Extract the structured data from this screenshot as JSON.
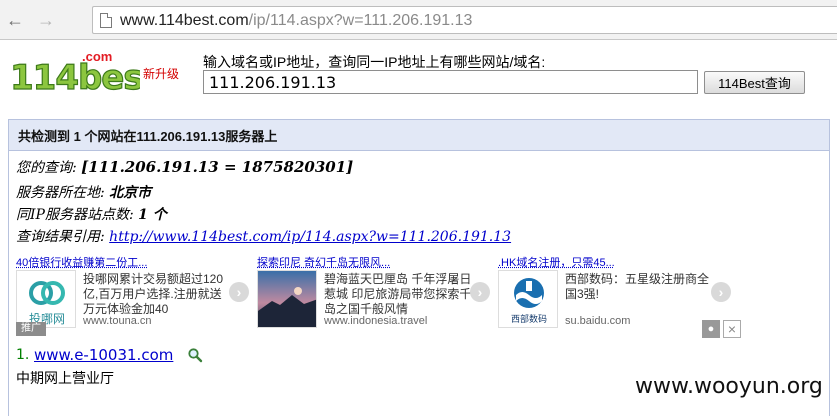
{
  "browser": {
    "url_host": "www.114best.com",
    "url_path": "/ip/114.aspx?w=111.206.191.13",
    "back_icon": "arrow-left-icon",
    "forward_icon": "arrow-right-icon"
  },
  "header": {
    "logo_text": "114best",
    "logo_suffix": ".com",
    "new_tag": "新升级",
    "search_hint": "输入域名或IP地址，查询同一IP地址上有哪些网站/域名:",
    "search_value": "111.206.191.13",
    "search_button": "114Best查询"
  },
  "result": {
    "summary": "共检测到 1 个网站在111.206.191.13服务器上",
    "query_label": "您的查询: ",
    "query_value": "[111.206.191.13 = 1875820301]",
    "location_label": "服务器所在地: ",
    "location_value": "北京市",
    "count_label": "同IP服务器站点数: ",
    "count_value": "1 个",
    "cite_label": "查询结果引用: ",
    "cite_url": "http://www.114best.com/ip/114.aspx?w=111.206.191.13"
  },
  "ads": [
    {
      "title": "40倍银行收益赚第二份工...",
      "desc": "投哪网累计交易额超过120亿,百万用户选择.注册就送万元体验金加40",
      "url": "www.touna.cn",
      "thumb_label": "投哪网"
    },
    {
      "title": "探索印尼 奇幻千岛无限风...",
      "desc": "碧海蓝天巴厘岛 千年浮屠日惹城 印尼旅游局带您探索千岛之国千般风情",
      "url": "www.indonesia.travel",
      "thumb_label": ""
    },
    {
      "title": ".HK域名注册，只需45...",
      "desc": "西部数码：五星级注册商全国3强!",
      "url": "su.baidu.com",
      "thumb_label": "西部数码"
    }
  ],
  "promo_tag": "推广",
  "sites": [
    {
      "num": "1.",
      "domain": "www.e-10031.com",
      "name": "中期网上营业厅"
    }
  ],
  "watermark": "www.wooyun.org",
  "colors": {
    "header_bg": "#e2e8f6",
    "link": "#0000cc",
    "new_tag": "#d40000"
  }
}
